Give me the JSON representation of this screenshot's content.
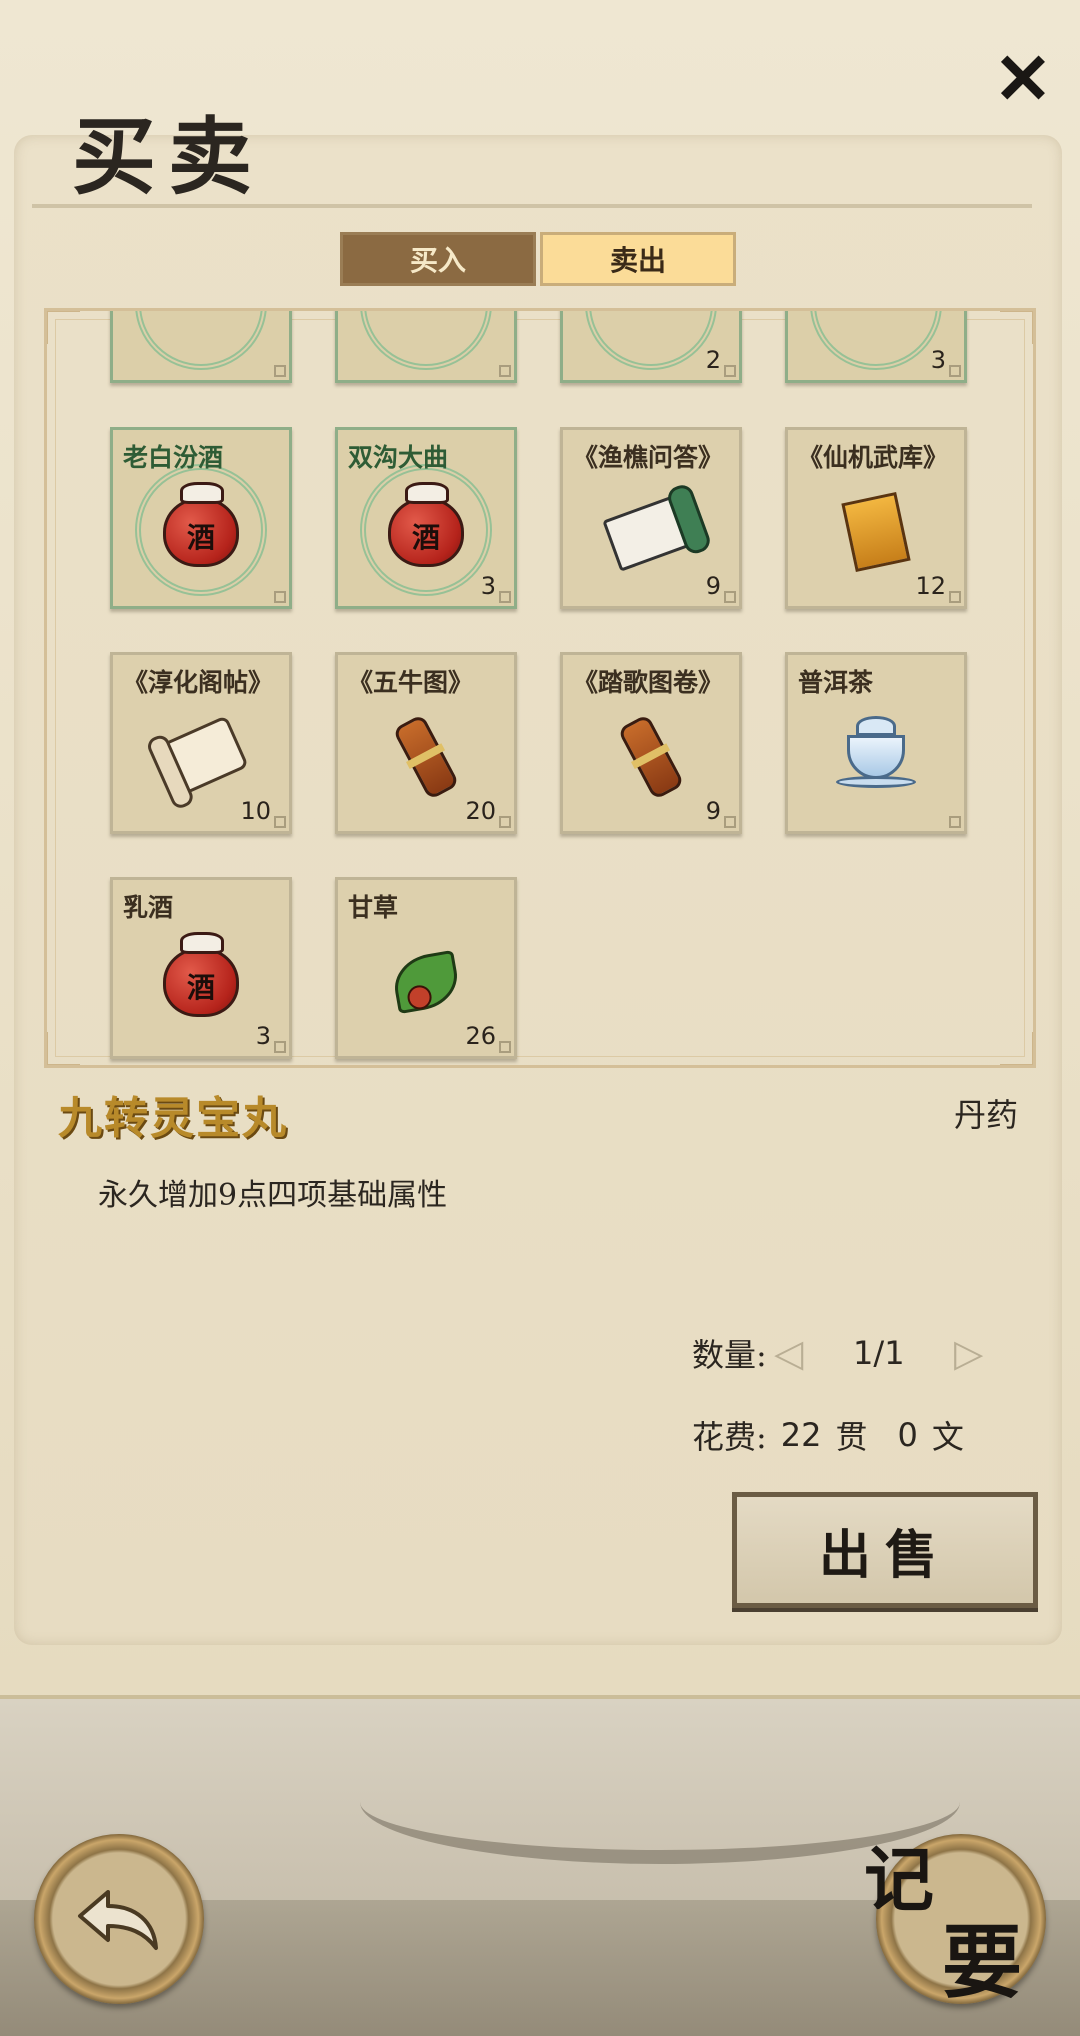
{
  "header": {
    "title": "买卖",
    "close_icon": "close-icon"
  },
  "tabs": [
    {
      "label": "买入",
      "active": false
    },
    {
      "label": "卖出",
      "active": true
    }
  ],
  "items_partial_top": [
    {
      "count": ""
    },
    {
      "count": ""
    },
    {
      "count": "2"
    },
    {
      "count": "3"
    }
  ],
  "items": [
    {
      "name": "老白汾酒",
      "count": "",
      "icon": "wine-jar-icon"
    },
    {
      "name": "双沟大曲",
      "count": "3",
      "icon": "wine-jar-icon"
    },
    {
      "name": "《渔樵问答》",
      "count": "9",
      "icon": "scroll-icon"
    },
    {
      "name": "《仙机武库》",
      "count": "12",
      "icon": "book-icon"
    },
    {
      "name": "《淳化阁帖》",
      "count": "10",
      "icon": "paper-scroll-icon"
    },
    {
      "name": "《五牛图》",
      "count": "20",
      "icon": "rolled-scroll-icon"
    },
    {
      "name": "《踏歌图卷》",
      "count": "9",
      "icon": "rolled-scroll-icon"
    },
    {
      "name": "普洱茶",
      "count": "",
      "icon": "tea-cup-icon"
    },
    {
      "name": "乳酒",
      "count": "3",
      "icon": "wine-jar-icon"
    },
    {
      "name": "甘草",
      "count": "26",
      "icon": "herb-icon"
    }
  ],
  "jar_glyph": "酒",
  "detail": {
    "name": "九转灵宝丸",
    "category": "丹药",
    "description": "永久增加9点四项基础属性"
  },
  "quantity": {
    "label": "数量:",
    "value": "1/1"
  },
  "cost": {
    "label": "花费:",
    "guan": "22",
    "guan_unit": "贯",
    "wen": "0",
    "wen_unit": "文"
  },
  "sell_button": "出售",
  "nav": {
    "back_icon": "back-arrow-icon",
    "notes_char1": "记",
    "notes_char2": "要"
  },
  "colors": {
    "accent_gold": "#b88a2a",
    "tab_active": "#fbdc98",
    "tab_inactive": "#8b6a42"
  }
}
